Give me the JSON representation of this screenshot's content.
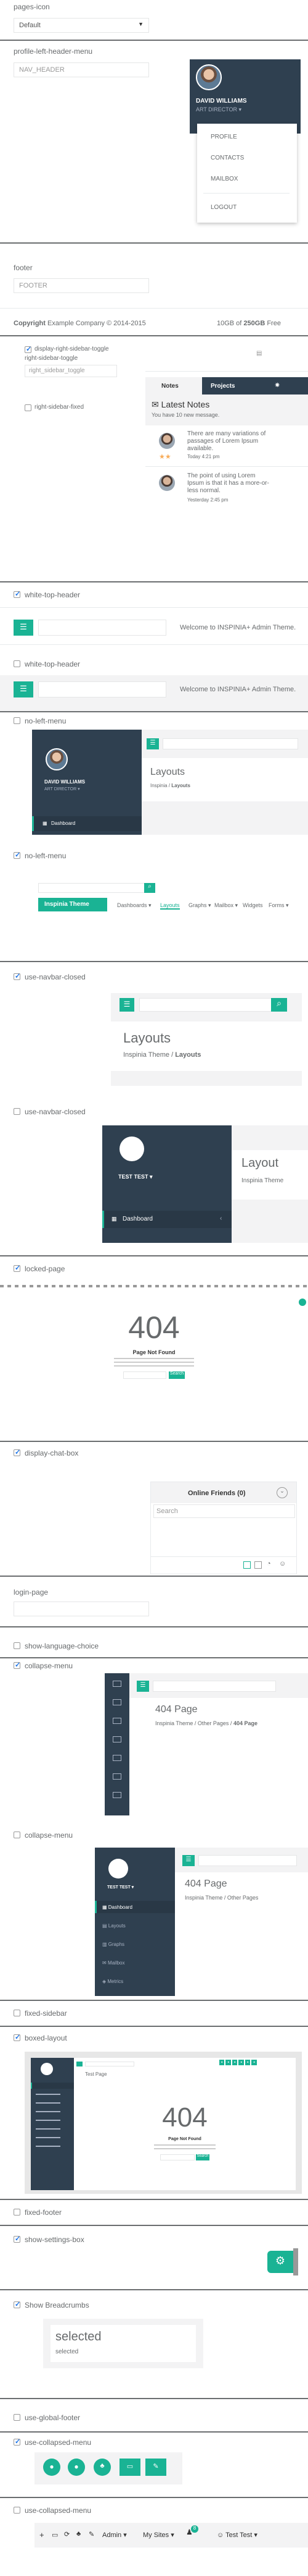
{
  "pages_icon": {
    "label": "pages-icon",
    "select_value": "Default"
  },
  "profile_menu": {
    "label": "profile-left-header-menu",
    "input_value": "NAV_HEADER",
    "name": "DAVID WILLIAMS",
    "role": "ART DIRECTOR",
    "items": [
      "PROFILE",
      "CONTACTS",
      "MAILBOX",
      "LOGOUT"
    ]
  },
  "footer_opt": {
    "label": "footer",
    "input_value": "FOOTER"
  },
  "footer_bar": {
    "copyright_bold": "Copyright",
    "copyright_rest": "Example Company © 2014-2015",
    "storage_pre": "10GB of ",
    "storage_bold": "250GB",
    "storage_post": " Free"
  },
  "right_sidebar": {
    "toggle_label": "display-right-sidebar-toggle",
    "toggle_label2": "right-sidebar-toggle",
    "input_value": "right_sidebar_toggle",
    "fixed_label": "right-sidebar-fixed",
    "tab_notes": "Notes",
    "tab_projects": "Projects",
    "latest_notes_title": "Latest Notes",
    "new_messages": "You have 10 new message.",
    "note1_text": "There are many variations of passages of Lorem Ipsum available.",
    "note1_time": "Today 4:21 pm",
    "note2_text": "The point of using Lorem Ipsum is that it has a more-or-less normal.",
    "note2_time": "Yesterday 2:45 pm"
  },
  "white_top_header_on": {
    "label": "white-top-header",
    "welcome": "Welcome to INSPINIA+ Admin Theme."
  },
  "white_top_header_off": {
    "label": "white-top-header",
    "welcome": "Welcome to INSPINIA+ Admin Theme."
  },
  "no_left_menu_off": {
    "label": "no-left-menu",
    "name": "DAVID WILLIAMS",
    "role": "ART DIRECTOR",
    "dashboard": "Dashboard",
    "heading": "Layouts",
    "crumb1": "Inspinia",
    "crumb2": "Layouts"
  },
  "no_left_menu_on": {
    "label": "no-left-menu",
    "brand": "Inspinia Theme",
    "tabs": [
      "Dashboards",
      "Layouts",
      "Graphs",
      "Mailbox",
      "Widgets",
      "Forms"
    ]
  },
  "navbar_closed_on": {
    "label": "use-navbar-closed",
    "heading": "Layouts",
    "crumb1": "Inspinia Theme",
    "crumb2": "Layouts"
  },
  "navbar_closed_off": {
    "label": "use-navbar-closed",
    "user": "TEST TEST",
    "dashboard": "Dashboard",
    "heading": "Layout",
    "crumb1": "Inspinia Theme"
  },
  "locked_page": {
    "label": "locked-page",
    "code": "404",
    "subtitle": "Page Not Found",
    "button": "Search"
  },
  "chat_box": {
    "label": "display-chat-box",
    "title": "Online Friends (0)",
    "search_placeholder": "Search"
  },
  "login_page": {
    "label": "login-page"
  },
  "language_choice": {
    "label": "show-language-choice"
  },
  "collapse_menu_on": {
    "label": "collapse-menu",
    "heading": "404 Page",
    "crumb1": "Inspinia Theme",
    "crumb2": "Other Pages",
    "crumb3": "404 Page"
  },
  "collapse_menu_off": {
    "label": "collapse-menu",
    "user": "TEST TEST",
    "heading": "404 Page",
    "crumb1": "Inspinia Theme",
    "crumb2": "Other Pages",
    "items": [
      "Dashboard",
      "Layouts",
      "Graphs",
      "Mailbox",
      "Metrics"
    ]
  },
  "fixed_sidebar": {
    "label": "fixed-sidebar"
  },
  "boxed_layout": {
    "label": "boxed-layout",
    "heading": "Test Page",
    "code": "404",
    "subtitle": "Page Not Found",
    "button": "Search"
  },
  "fixed_footer": {
    "label": "fixed-footer"
  },
  "settings_box": {
    "label": "show-settings-box"
  },
  "breadcrumbs": {
    "label": "Show Breadcrumbs",
    "title": "selected",
    "crumb": "selected"
  },
  "global_footer": {
    "label": "use-global-footer"
  },
  "collapsed_menu_on": {
    "label": "use-collapsed-menu"
  },
  "collapsed_menu_off": {
    "label": "use-collapsed-menu",
    "admin": "Admin",
    "sites": "My Sites",
    "user": "Test Test",
    "badge": "8"
  },
  "colors": {
    "navy": "#2f4050",
    "green": "#1ab394",
    "text": "#676a6c"
  }
}
